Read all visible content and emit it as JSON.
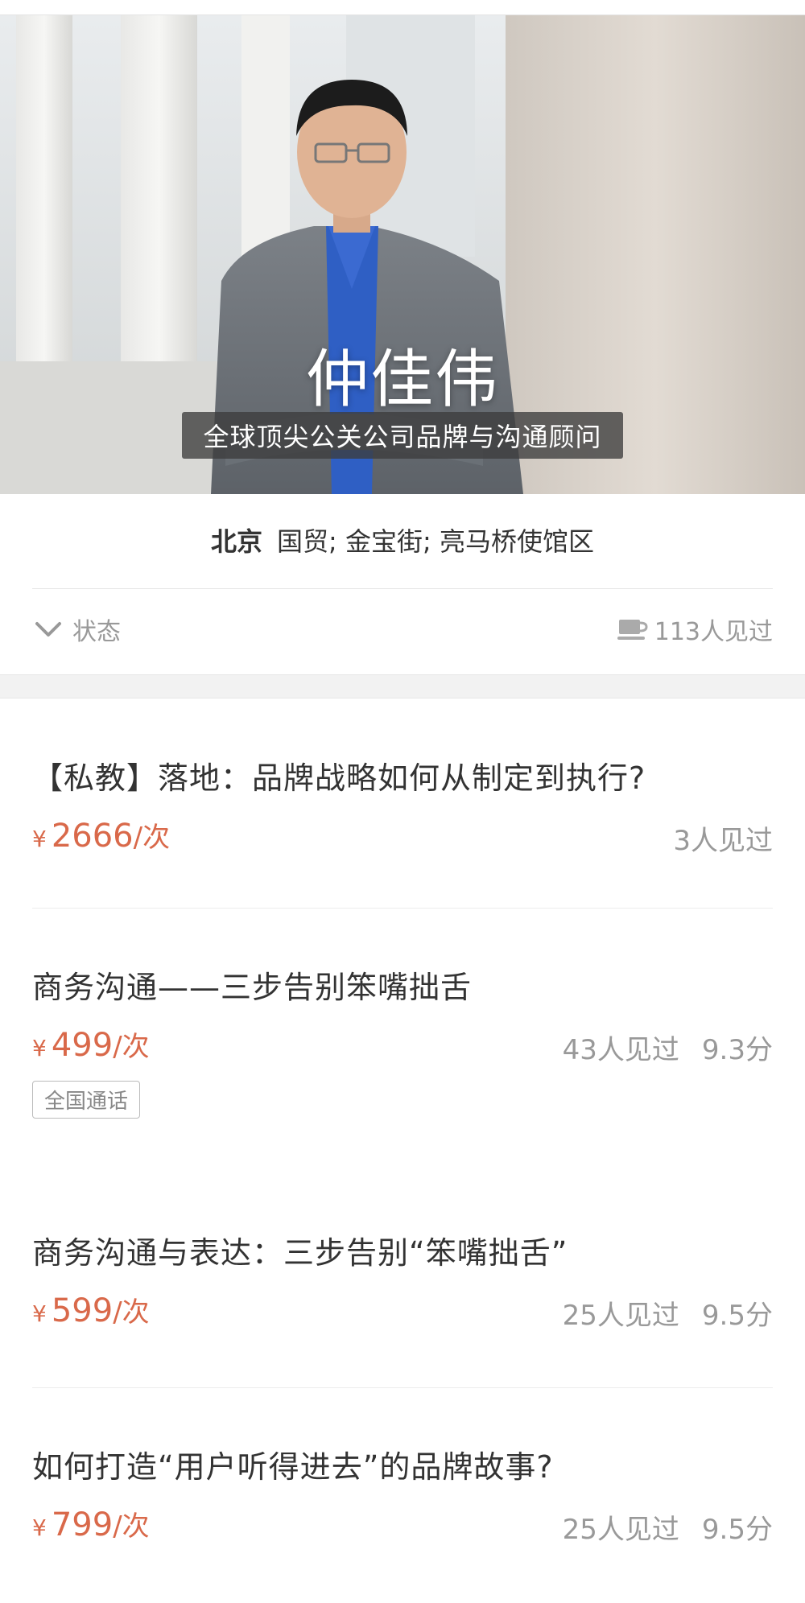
{
  "profile": {
    "name": "仲佳伟",
    "tagline": "全球顶尖公关公司品牌与沟通顾问",
    "city": "北京",
    "areas": "国贸; 金宝街; 亮马桥使馆区"
  },
  "status_bar": {
    "toggle_label": "状态",
    "seen_total": "113人见过"
  },
  "services": [
    {
      "title": "【私教】落地：品牌战略如何从制定到执行?",
      "yen": "¥",
      "price": "2666",
      "unit": "/次",
      "seen": "3人见过",
      "score": ""
    },
    {
      "title": "商务沟通——三步告别笨嘴拙舌",
      "yen": "¥",
      "price": "499",
      "unit": "/次",
      "seen": "43人见过",
      "score": "9.3分",
      "tag": "全国通话"
    },
    {
      "title": "商务沟通与表达：三步告别“笨嘴拙舌”",
      "yen": "¥",
      "price": "599",
      "unit": "/次",
      "seen": "25人见过",
      "score": "9.5分"
    },
    {
      "title": "如何打造“用户听得进去”的品牌故事?",
      "yen": "¥",
      "price": "799",
      "unit": "/次",
      "seen": "25人见过",
      "score": "9.5分"
    }
  ],
  "colors": {
    "price": "#d9694a",
    "muted": "#999999",
    "text": "#333333"
  },
  "icons": {
    "status_toggle": "chevron-down-icon",
    "seen": "coffee-cup-icon"
  }
}
